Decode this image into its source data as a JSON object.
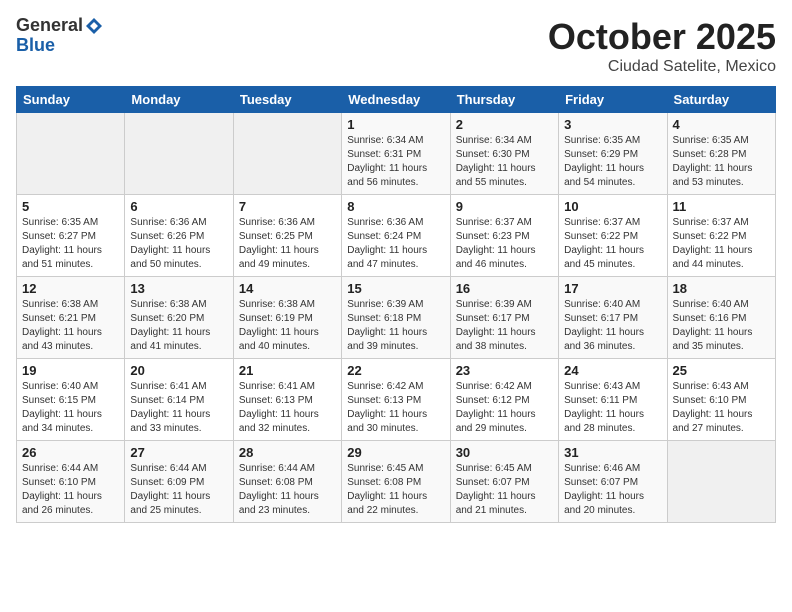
{
  "logo": {
    "line1": "General",
    "line2": "Blue"
  },
  "header": {
    "month": "October 2025",
    "location": "Ciudad Satelite, Mexico"
  },
  "days_of_week": [
    "Sunday",
    "Monday",
    "Tuesday",
    "Wednesday",
    "Thursday",
    "Friday",
    "Saturday"
  ],
  "weeks": [
    [
      {
        "day": "",
        "info": ""
      },
      {
        "day": "",
        "info": ""
      },
      {
        "day": "",
        "info": ""
      },
      {
        "day": "1",
        "info": "Sunrise: 6:34 AM\nSunset: 6:31 PM\nDaylight: 11 hours\nand 56 minutes."
      },
      {
        "day": "2",
        "info": "Sunrise: 6:34 AM\nSunset: 6:30 PM\nDaylight: 11 hours\nand 55 minutes."
      },
      {
        "day": "3",
        "info": "Sunrise: 6:35 AM\nSunset: 6:29 PM\nDaylight: 11 hours\nand 54 minutes."
      },
      {
        "day": "4",
        "info": "Sunrise: 6:35 AM\nSunset: 6:28 PM\nDaylight: 11 hours\nand 53 minutes."
      }
    ],
    [
      {
        "day": "5",
        "info": "Sunrise: 6:35 AM\nSunset: 6:27 PM\nDaylight: 11 hours\nand 51 minutes."
      },
      {
        "day": "6",
        "info": "Sunrise: 6:36 AM\nSunset: 6:26 PM\nDaylight: 11 hours\nand 50 minutes."
      },
      {
        "day": "7",
        "info": "Sunrise: 6:36 AM\nSunset: 6:25 PM\nDaylight: 11 hours\nand 49 minutes."
      },
      {
        "day": "8",
        "info": "Sunrise: 6:36 AM\nSunset: 6:24 PM\nDaylight: 11 hours\nand 47 minutes."
      },
      {
        "day": "9",
        "info": "Sunrise: 6:37 AM\nSunset: 6:23 PM\nDaylight: 11 hours\nand 46 minutes."
      },
      {
        "day": "10",
        "info": "Sunrise: 6:37 AM\nSunset: 6:22 PM\nDaylight: 11 hours\nand 45 minutes."
      },
      {
        "day": "11",
        "info": "Sunrise: 6:37 AM\nSunset: 6:22 PM\nDaylight: 11 hours\nand 44 minutes."
      }
    ],
    [
      {
        "day": "12",
        "info": "Sunrise: 6:38 AM\nSunset: 6:21 PM\nDaylight: 11 hours\nand 43 minutes."
      },
      {
        "day": "13",
        "info": "Sunrise: 6:38 AM\nSunset: 6:20 PM\nDaylight: 11 hours\nand 41 minutes."
      },
      {
        "day": "14",
        "info": "Sunrise: 6:38 AM\nSunset: 6:19 PM\nDaylight: 11 hours\nand 40 minutes."
      },
      {
        "day": "15",
        "info": "Sunrise: 6:39 AM\nSunset: 6:18 PM\nDaylight: 11 hours\nand 39 minutes."
      },
      {
        "day": "16",
        "info": "Sunrise: 6:39 AM\nSunset: 6:17 PM\nDaylight: 11 hours\nand 38 minutes."
      },
      {
        "day": "17",
        "info": "Sunrise: 6:40 AM\nSunset: 6:17 PM\nDaylight: 11 hours\nand 36 minutes."
      },
      {
        "day": "18",
        "info": "Sunrise: 6:40 AM\nSunset: 6:16 PM\nDaylight: 11 hours\nand 35 minutes."
      }
    ],
    [
      {
        "day": "19",
        "info": "Sunrise: 6:40 AM\nSunset: 6:15 PM\nDaylight: 11 hours\nand 34 minutes."
      },
      {
        "day": "20",
        "info": "Sunrise: 6:41 AM\nSunset: 6:14 PM\nDaylight: 11 hours\nand 33 minutes."
      },
      {
        "day": "21",
        "info": "Sunrise: 6:41 AM\nSunset: 6:13 PM\nDaylight: 11 hours\nand 32 minutes."
      },
      {
        "day": "22",
        "info": "Sunrise: 6:42 AM\nSunset: 6:13 PM\nDaylight: 11 hours\nand 30 minutes."
      },
      {
        "day": "23",
        "info": "Sunrise: 6:42 AM\nSunset: 6:12 PM\nDaylight: 11 hours\nand 29 minutes."
      },
      {
        "day": "24",
        "info": "Sunrise: 6:43 AM\nSunset: 6:11 PM\nDaylight: 11 hours\nand 28 minutes."
      },
      {
        "day": "25",
        "info": "Sunrise: 6:43 AM\nSunset: 6:10 PM\nDaylight: 11 hours\nand 27 minutes."
      }
    ],
    [
      {
        "day": "26",
        "info": "Sunrise: 6:44 AM\nSunset: 6:10 PM\nDaylight: 11 hours\nand 26 minutes."
      },
      {
        "day": "27",
        "info": "Sunrise: 6:44 AM\nSunset: 6:09 PM\nDaylight: 11 hours\nand 25 minutes."
      },
      {
        "day": "28",
        "info": "Sunrise: 6:44 AM\nSunset: 6:08 PM\nDaylight: 11 hours\nand 23 minutes."
      },
      {
        "day": "29",
        "info": "Sunrise: 6:45 AM\nSunset: 6:08 PM\nDaylight: 11 hours\nand 22 minutes."
      },
      {
        "day": "30",
        "info": "Sunrise: 6:45 AM\nSunset: 6:07 PM\nDaylight: 11 hours\nand 21 minutes."
      },
      {
        "day": "31",
        "info": "Sunrise: 6:46 AM\nSunset: 6:07 PM\nDaylight: 11 hours\nand 20 minutes."
      },
      {
        "day": "",
        "info": ""
      }
    ]
  ]
}
